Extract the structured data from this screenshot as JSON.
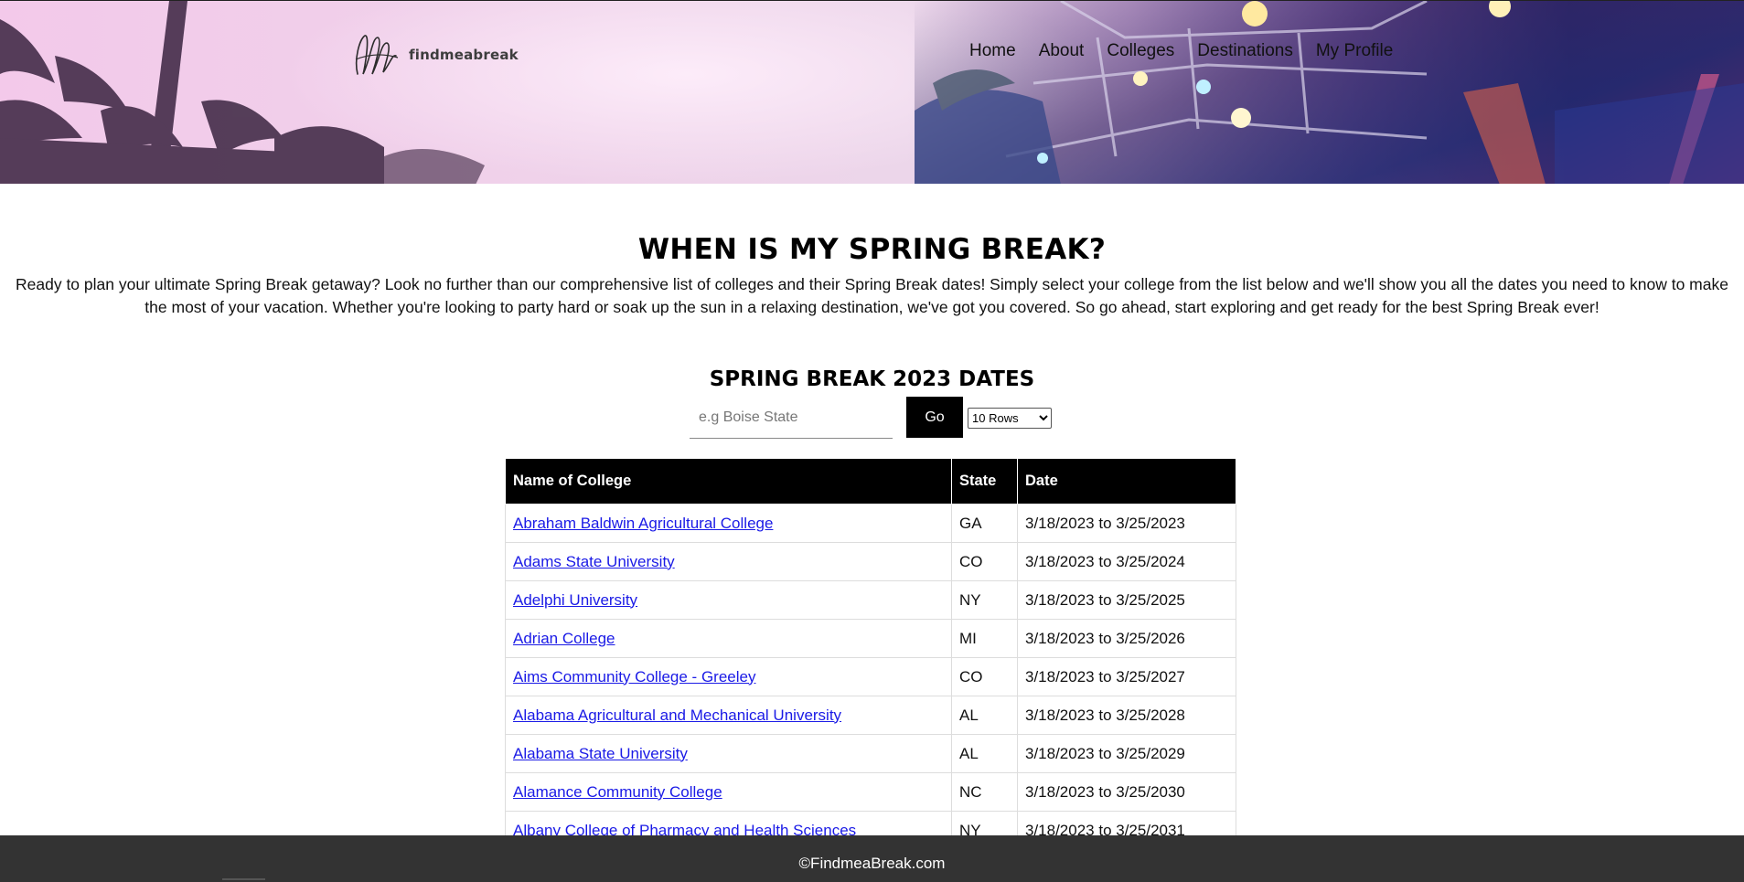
{
  "header": {
    "logo_text": "findmeabreak",
    "nav": [
      {
        "label": "Home"
      },
      {
        "label": "About"
      },
      {
        "label": "Colleges"
      },
      {
        "label": "Destinations"
      },
      {
        "label": "My Profile"
      }
    ]
  },
  "main": {
    "title": "WHEN IS MY SPRING BREAK?",
    "intro": "Ready to plan your ultimate Spring Break getaway? Look no further than our comprehensive list of colleges and their Spring Break dates! Simply select your college from the list below and we'll show you all the dates you need to know to make the most of your vacation. Whether you're looking to party hard or soak up the sun in a relaxing destination, we've got you covered. So go ahead, start exploring and get ready for the best Spring Break ever!",
    "section_title": "SPRING BREAK 2023 DATES",
    "search": {
      "placeholder": "e.g Boise State",
      "value": ""
    },
    "go_label": "Go",
    "rows_selected": "10 Rows"
  },
  "table": {
    "headers": [
      "Name of College",
      "State",
      "Date"
    ],
    "rows": [
      {
        "name": "Abraham Baldwin Agricultural College",
        "state": "GA",
        "date": "3/18/2023 to 3/25/2023"
      },
      {
        "name": "Adams State University",
        "state": "CO",
        "date": "3/18/2023 to 3/25/2024"
      },
      {
        "name": "Adelphi University",
        "state": "NY",
        "date": "3/18/2023 to 3/25/2025"
      },
      {
        "name": "Adrian College",
        "state": "MI",
        "date": "3/18/2023 to 3/25/2026"
      },
      {
        "name": "Aims Community College - Greeley",
        "state": "CO",
        "date": "3/18/2023 to 3/25/2027"
      },
      {
        "name": "Alabama Agricultural and Mechanical University",
        "state": "AL",
        "date": "3/18/2023 to 3/25/2028"
      },
      {
        "name": "Alabama State University",
        "state": "AL",
        "date": "3/18/2023 to 3/25/2029"
      },
      {
        "name": "Alamance Community College",
        "state": "NC",
        "date": "3/18/2023 to 3/25/2030"
      },
      {
        "name": "Albany College of Pharmacy and Health Sciences",
        "state": "NY",
        "date": "3/18/2023 to 3/25/2031"
      }
    ]
  },
  "footer": {
    "text": "©FindmeaBreak.com"
  }
}
